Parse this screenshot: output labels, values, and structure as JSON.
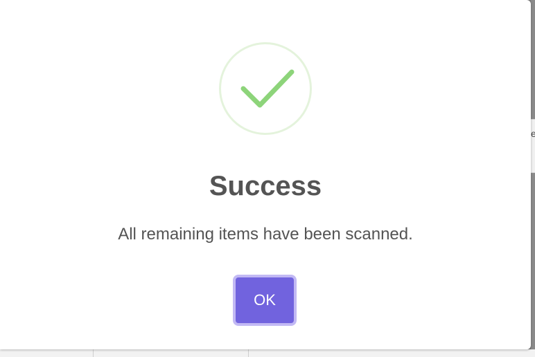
{
  "background": {
    "right_edge_fragment": "e"
  },
  "dialog": {
    "icon": "success-check-icon",
    "title": "Success",
    "message": "All remaining items have been scanned.",
    "confirm_label": "OK"
  },
  "colors": {
    "accent": "#7163de",
    "accent_focus_ring": "#c2b9f4",
    "success_check": "#8dd47a",
    "success_ring": "#e4f3dc",
    "text": "#545454"
  }
}
